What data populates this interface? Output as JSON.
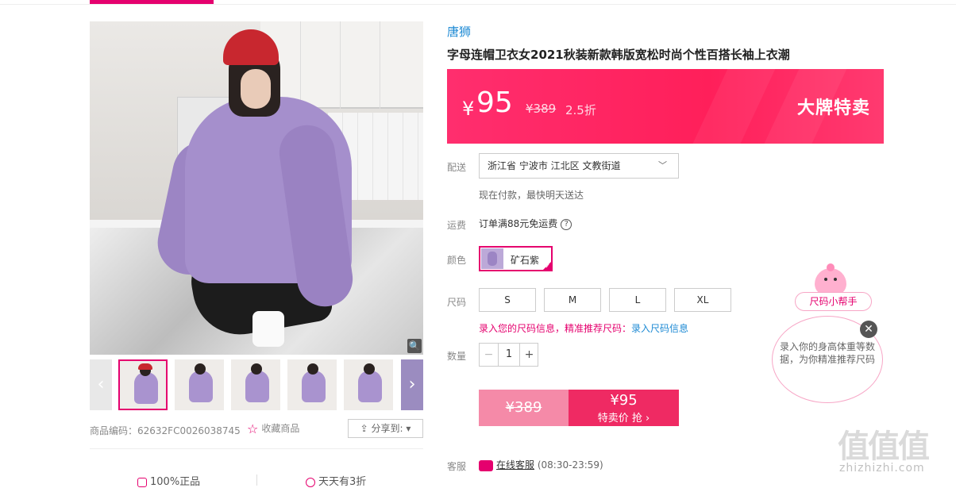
{
  "product": {
    "brand": "唐狮",
    "title": "字母连帽卫衣女2021秋装新款韩版宽松时尚个性百搭长袖上衣潮",
    "code_label": "商品编码：62632FC0026038745",
    "favorite_label": "收藏商品",
    "share_label": "分享到:"
  },
  "price": {
    "currency": "¥",
    "current": "95",
    "original": "¥389",
    "discount": "2.5折",
    "tag": "大牌特卖"
  },
  "delivery": {
    "label": "配送",
    "address": "浙江省 宁波市 江北区 文教街道",
    "note": "现在付款，最快明天送达"
  },
  "freight": {
    "label": "运费",
    "text": "订单满88元免运费"
  },
  "color": {
    "label": "颜色",
    "selected": "矿石紫"
  },
  "size": {
    "label": "尺码",
    "options": [
      "S",
      "M",
      "L",
      "XL"
    ],
    "tip_text": "录入您的尺码信息，精准推荐尺码：",
    "tip_link": "录入尺码信息"
  },
  "quantity": {
    "label": "数量",
    "value": "1",
    "minus": "−",
    "plus": "+"
  },
  "buy": {
    "orig_price": "¥389",
    "now_price": "¥95",
    "now_label": "特卖价 抢 ›"
  },
  "service": {
    "label": "客服",
    "link": "在线客服",
    "hours": "(08:30-23:59)"
  },
  "guarantees": [
    "100%正品",
    "天天有3折"
  ],
  "helper": {
    "label": "尺码小帮手",
    "bubble": "录入你的身高体重等数据，为你精准推荐尺码",
    "close": "✕"
  },
  "gallery": {
    "zoom_icon": "🔍",
    "prev": "‹",
    "next": "›"
  },
  "watermark": {
    "logo": "值值值",
    "url": "zhizhizhi.com"
  },
  "colors": {
    "accent": "#e5006e",
    "banner": "#ff2e6e",
    "link": "#1e8ad4"
  }
}
